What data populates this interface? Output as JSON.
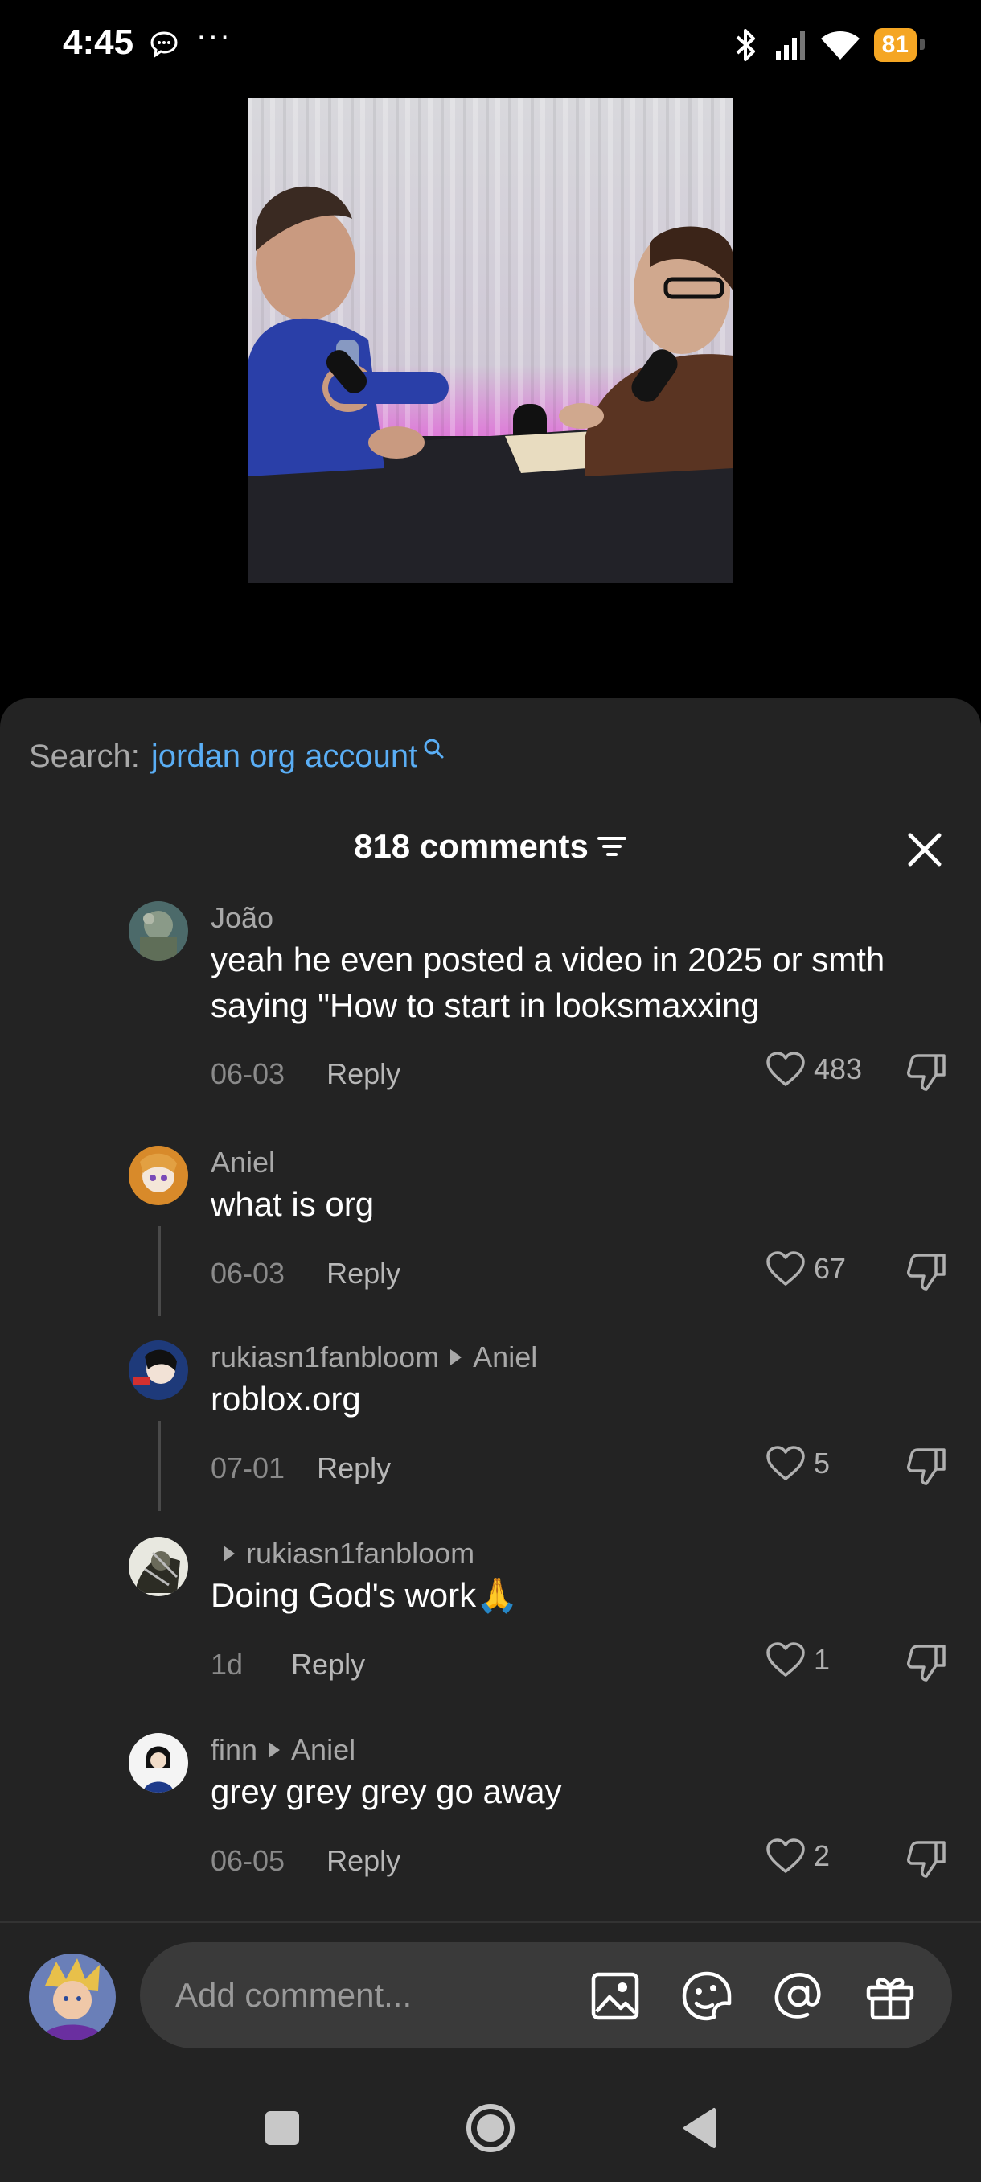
{
  "status_bar": {
    "time": "4:45",
    "dots": "···",
    "battery": "81"
  },
  "search": {
    "label": "Search:",
    "query": "jordan org account"
  },
  "header": {
    "title": "818 comments"
  },
  "comments": [
    {
      "user": "João",
      "reply_to": "",
      "text": "yeah he even posted a video in 2025 or smth saying \"How to start in looksmaxxing",
      "date": "06-03",
      "reply": "Reply",
      "likes": "483"
    },
    {
      "user": "Aniel",
      "reply_to": "",
      "text": "what is org",
      "date": "06-03",
      "reply": "Reply",
      "likes": "67"
    },
    {
      "user": "rukiasn1fanbloom",
      "reply_to": "Aniel",
      "text": "roblox.org",
      "date": "07-01",
      "reply": "Reply",
      "likes": "5"
    },
    {
      "user": "",
      "reply_to": "rukiasn1fanbloom",
      "text": "Doing God's work🙏",
      "date": "1d",
      "reply": "Reply",
      "likes": "1"
    },
    {
      "user": "finn",
      "reply_to": "Aniel",
      "text": "grey grey grey go away",
      "date": "06-05",
      "reply": "Reply",
      "likes": "2"
    }
  ],
  "composer": {
    "placeholder": "Add comment..."
  },
  "icons": [
    "message-icon",
    "bluetooth-icon",
    "signal-icon",
    "wifi-icon",
    "search-icon",
    "filter-icon",
    "close-icon",
    "heart-icon",
    "dislike-icon",
    "image-icon",
    "sticker-icon",
    "mention-icon",
    "gift-icon",
    "nav-square-icon",
    "nav-home-icon",
    "nav-back-icon"
  ],
  "colors": {
    "sheet_bg": "#232323",
    "accent_link": "#5aaef5",
    "battery": "#f5a623"
  }
}
